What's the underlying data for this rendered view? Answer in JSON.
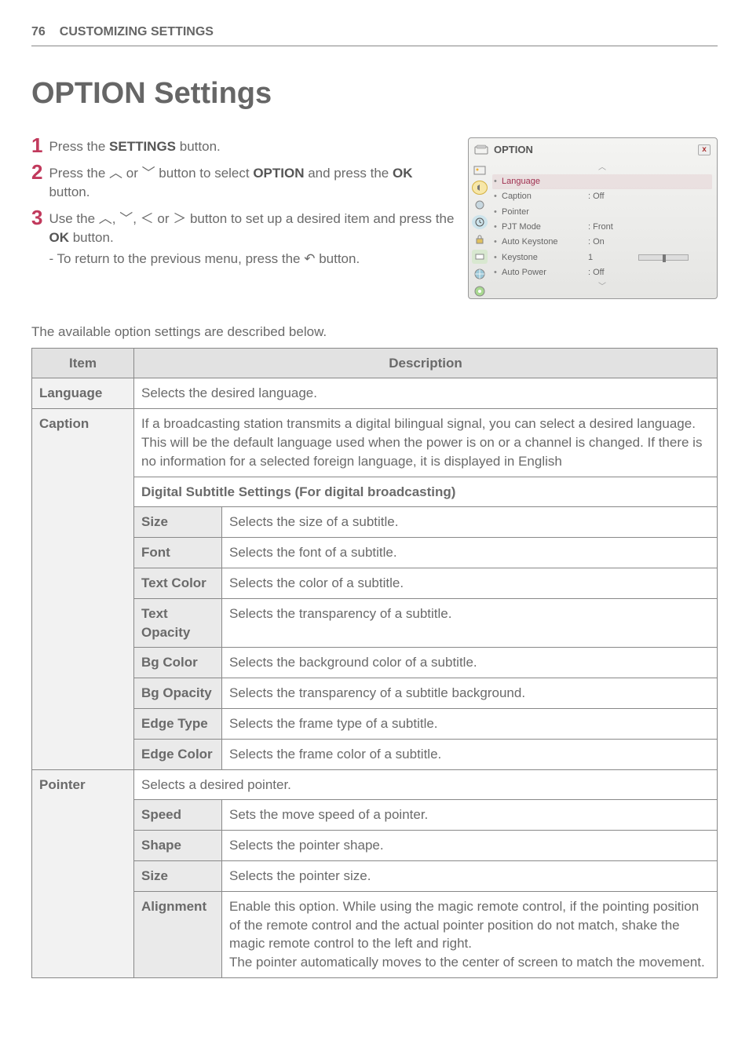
{
  "header": {
    "page_num": "76",
    "title": "CUSTOMIZING SETTINGS"
  },
  "main_title": "OPTION Settings",
  "steps": [
    {
      "n": "1",
      "text_pre": "Press the ",
      "b1": "SETTINGS",
      "text_post": " button."
    },
    {
      "n": "2",
      "text_pre": "Press the ",
      "sym1": "︿",
      "mid": " or ",
      "sym2": "﹀",
      "mid2": " button to select ",
      "b1": "OPTION",
      "text_post": " and press the ",
      "b2": "OK",
      "text_post2": " button."
    },
    {
      "n": "3",
      "text_pre": "Use the ",
      "sym1": "︿",
      "mid": ", ",
      "sym2": "﹀",
      "mid2": ", ",
      "sym3": "＜",
      "mid3": " or ",
      "sym4": "＞",
      "mid4": " button to set up a desired item and press the ",
      "b1": "OK",
      "text_post": " button.",
      "note_pre": "- To return to the previous menu, press the ",
      "note_icon": "↶",
      "note_post": " button."
    }
  ],
  "panel": {
    "title": "OPTION",
    "close": "x",
    "up": "︿",
    "down": "﹀",
    "rows": [
      {
        "label": "Language",
        "val": "",
        "sel": true
      },
      {
        "label": "Caption",
        "val": ": Off"
      },
      {
        "label": "Pointer",
        "val": ""
      },
      {
        "label": "PJT Mode",
        "val": ": Front"
      },
      {
        "label": "Auto Keystone",
        "val": ": On"
      },
      {
        "label": "Keystone",
        "val": "1",
        "slider": true
      },
      {
        "label": "Auto Power",
        "val": ": Off"
      }
    ]
  },
  "caption_line": "The available option settings are described below.",
  "table": {
    "headers": {
      "item": "Item",
      "desc": "Description"
    },
    "rows": {
      "language": {
        "label": "Language",
        "desc": "Selects the desired language."
      },
      "caption": {
        "label": "Caption",
        "intro": "If a broadcasting station transmits a digital bilingual signal, you can select a desired language. This will be the default language used when the power is on or a channel is changed. If there is no information for a selected foreign language, it is displayed in English",
        "subtitle_heading": "Digital Subtitle Settings (For digital broadcasting)",
        "sub": [
          {
            "k": "Size",
            "v": "Selects the size of a subtitle."
          },
          {
            "k": "Font",
            "v": "Selects the font of a subtitle."
          },
          {
            "k": "Text Color",
            "v": "Selects the color of a subtitle."
          },
          {
            "k": "Text Opacity",
            "v": "Selects the transparency of a subtitle."
          },
          {
            "k": "Bg Color",
            "v": "Selects the background color of a subtitle."
          },
          {
            "k": "Bg Opacity",
            "v": "Selects the transparency of a subtitle background."
          },
          {
            "k": "Edge Type",
            "v": "Selects the frame type of a subtitle."
          },
          {
            "k": "Edge Color",
            "v": "Selects the frame color of a subtitle."
          }
        ]
      },
      "pointer": {
        "label": "Pointer",
        "intro": "Selects a desired pointer.",
        "sub": [
          {
            "k": "Speed",
            "v": "Sets the move speed of a pointer."
          },
          {
            "k": "Shape",
            "v": "Selects the pointer shape."
          },
          {
            "k": "Size",
            "v": "Selects the pointer size."
          },
          {
            "k": "Alignment",
            "v": "Enable this option. While using the magic remote control, if the pointing position of the remote control and the actual pointer position do not match, shake the magic remote control to the left and right.\nThe pointer automatically moves to the center of screen to match the movement."
          }
        ]
      }
    }
  }
}
